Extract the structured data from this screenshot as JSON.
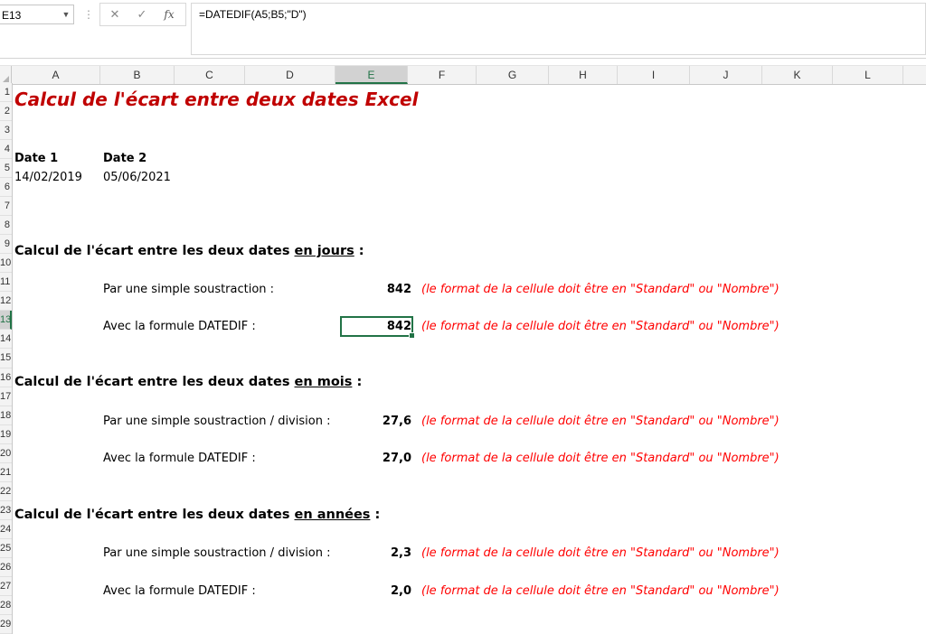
{
  "formula_bar": {
    "name_box": "E13",
    "dots": "⋮",
    "cancel": "✕",
    "confirm": "✓",
    "fx": "fx",
    "formula": "=DATEDIF(A5;B5;\"D\")"
  },
  "columns": [
    "A",
    "B",
    "C",
    "D",
    "E",
    "F",
    "G",
    "H",
    "I",
    "J",
    "K",
    "L"
  ],
  "selected_column": "E",
  "rows": [
    "1",
    "2",
    "3",
    "4",
    "5",
    "6",
    "7",
    "8",
    "9",
    "10",
    "11",
    "12",
    "13",
    "14",
    "15",
    "16",
    "17",
    "18",
    "19",
    "20",
    "21",
    "22",
    "23",
    "24",
    "25",
    "26",
    "27",
    "28",
    "29"
  ],
  "selected_row": "13",
  "sheet": {
    "title": "Calcul de l'écart entre deux dates Excel",
    "date1_label": "Date 1",
    "date2_label": "Date 2",
    "date1_value": "14/02/2019",
    "date2_value": "05/06/2021",
    "sections": [
      {
        "heading_prefix": "Calcul de l'écart entre les deux dates ",
        "heading_unit": "en jours",
        "heading_suffix": " :",
        "rows": [
          {
            "label": "Par une simple soustraction :",
            "value": "842",
            "note": "(le format de la cellule doit être en \"Standard\" ou \"Nombre\")"
          },
          {
            "label": "Avec la formule DATEDIF :",
            "value": "842",
            "note": "(le format de la cellule doit être en \"Standard\" ou \"Nombre\")"
          }
        ]
      },
      {
        "heading_prefix": "Calcul de l'écart entre les deux dates ",
        "heading_unit": "en mois",
        "heading_suffix": " :",
        "rows": [
          {
            "label": "Par une simple soustraction / division :",
            "value": "27,6",
            "note": "(le format de la cellule doit être en \"Standard\" ou \"Nombre\")"
          },
          {
            "label": "Avec la formule DATEDIF :",
            "value": "27,0",
            "note": "(le format de la cellule doit être en \"Standard\" ou \"Nombre\")"
          }
        ]
      },
      {
        "heading_prefix": "Calcul de l'écart entre les deux dates ",
        "heading_unit": "en années",
        "heading_suffix": " :",
        "rows": [
          {
            "label": "Par une simple soustraction / division :",
            "value": "2,3",
            "note": "(le format de la cellule doit être en \"Standard\" ou \"Nombre\")"
          },
          {
            "label": "Avec la formule DATEDIF :",
            "value": "2,0",
            "note": "(le format de la cellule doit être en \"Standard\" ou \"Nombre\")"
          }
        ]
      }
    ]
  }
}
